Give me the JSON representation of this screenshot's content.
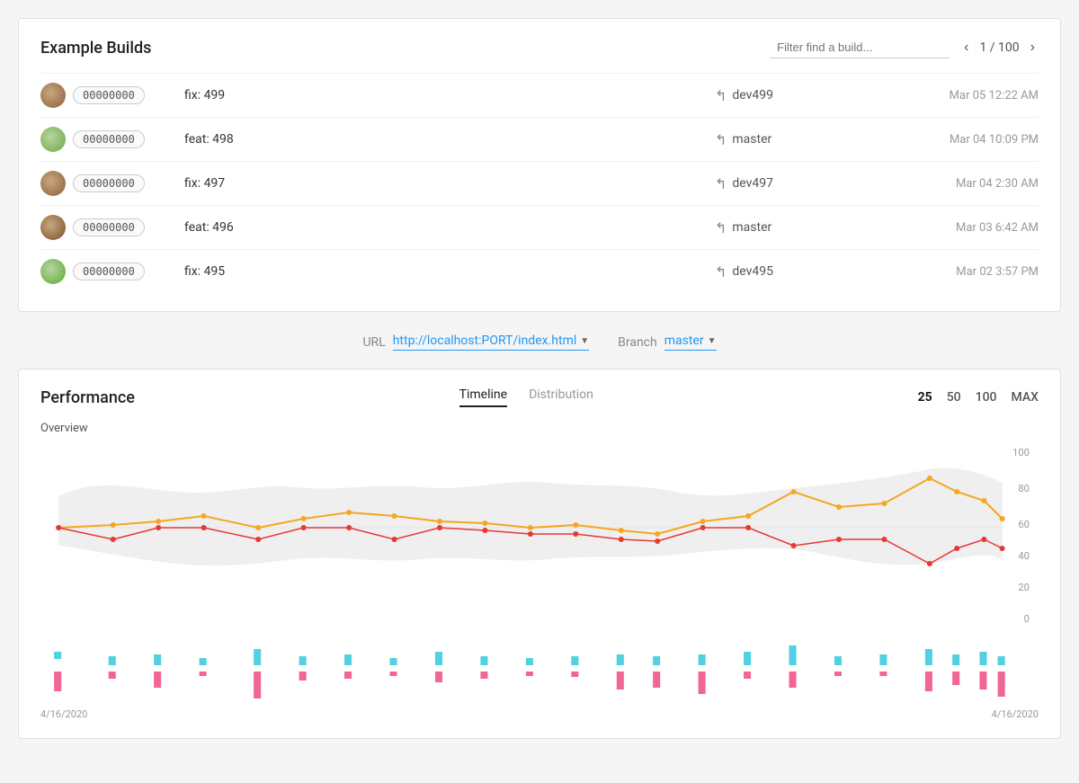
{
  "page": {
    "title": "Example Builds"
  },
  "filter": {
    "placeholder": "Filter find a build..."
  },
  "pagination": {
    "current": 1,
    "total": 100,
    "display": "1 / 100"
  },
  "builds": [
    {
      "id": "00000000",
      "label": "fix: 499",
      "branch": "dev499",
      "date": "Mar 05 12:22 AM",
      "avatar_class": "avatar-1"
    },
    {
      "id": "00000000",
      "label": "feat: 498",
      "branch": "master",
      "date": "Mar 04 10:09 PM",
      "avatar_class": "avatar-2"
    },
    {
      "id": "00000000",
      "label": "fix: 497",
      "branch": "dev497",
      "date": "Mar 04 2:30 AM",
      "avatar_class": "avatar-3"
    },
    {
      "id": "00000000",
      "label": "feat: 496",
      "branch": "master",
      "date": "Mar 03 6:42 AM",
      "avatar_class": "avatar-4"
    },
    {
      "id": "00000000",
      "label": "fix: 495",
      "branch": "dev495",
      "date": "Mar 02 3:57 PM",
      "avatar_class": "avatar-5"
    }
  ],
  "selector": {
    "url_label": "URL",
    "url_value": "http://localhost:PORT/index.html",
    "branch_label": "Branch",
    "branch_value": "master"
  },
  "performance": {
    "title": "Performance",
    "tabs": [
      "Timeline",
      "Distribution"
    ],
    "active_tab": "Timeline",
    "ranges": [
      "25",
      "50",
      "100",
      "MAX"
    ],
    "active_range": "25",
    "chart_label": "Overview",
    "date_start": "4/16/2020",
    "date_end": "4/16/2020",
    "y_axis": [
      "100",
      "80",
      "60",
      "40",
      "20",
      "0"
    ]
  }
}
